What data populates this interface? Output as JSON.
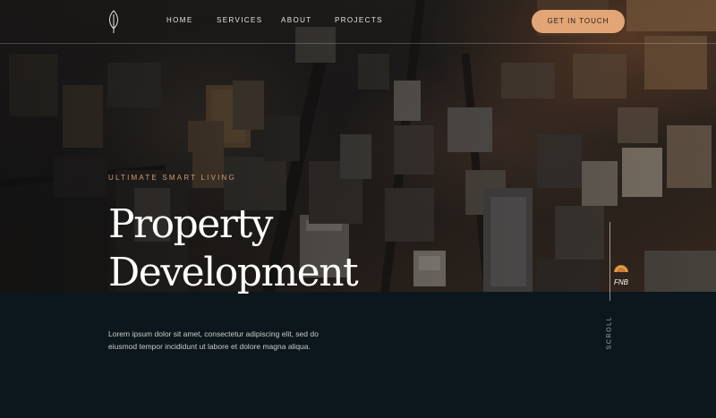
{
  "nav": {
    "items": [
      {
        "label": "HOME"
      },
      {
        "label": "SERVICES"
      },
      {
        "label": "ABOUT"
      },
      {
        "label": "PROJECTS"
      }
    ],
    "cta_label": "GET IN TOUCH"
  },
  "hero": {
    "eyebrow": "ULTIMATE SMART LIVING",
    "title_line1": "Property",
    "title_line2": "Development",
    "building_sign": "FNB"
  },
  "intro": {
    "text": "Lorem ipsum dolor sit amet, consectetur adipiscing elit, sed do eiusmod tempor incididunt ut labore et dolore magna aliqua."
  },
  "scroll": {
    "label": "SCROLL"
  },
  "colors": {
    "accent": "#e2a676",
    "eyebrow": "#cf9d74",
    "panel": "#0b171c",
    "nav_text": "#e9e4dc"
  },
  "icons": {
    "logo": "leaf-icon"
  }
}
